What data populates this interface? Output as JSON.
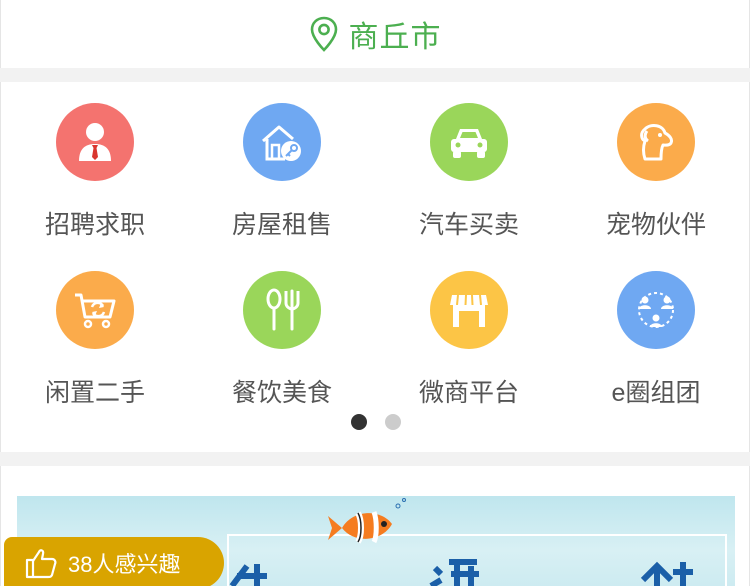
{
  "location": {
    "city": "商丘市",
    "icon": "location-pin-icon",
    "color": "#4caf50"
  },
  "categories": [
    {
      "label": "招聘求职",
      "icon": "recruitment-icon",
      "color": "#f4736f"
    },
    {
      "label": "房屋租售",
      "icon": "house-key-icon",
      "color": "#6fa8f2"
    },
    {
      "label": "汽车买卖",
      "icon": "car-icon",
      "color": "#9ad65a"
    },
    {
      "label": "宠物伙伴",
      "icon": "pet-dog-icon",
      "color": "#fbab4b"
    },
    {
      "label": "闲置二手",
      "icon": "recycle-cart-icon",
      "color": "#fbab4b"
    },
    {
      "label": "餐饮美食",
      "icon": "spoon-fork-icon",
      "color": "#9ad65a"
    },
    {
      "label": "微商平台",
      "icon": "storefront-icon",
      "color": "#fcc546"
    },
    {
      "label": "e圈组团",
      "icon": "group-circle-icon",
      "color": "#6fa8f2"
    }
  ],
  "pager": {
    "pages": 2,
    "active": 0
  },
  "interest": {
    "text": "38人感兴趣",
    "icon": "thumbs-up-icon",
    "color": "#d9a400"
  }
}
